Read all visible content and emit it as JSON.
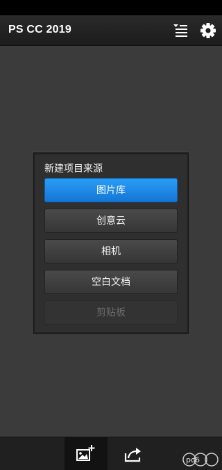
{
  "app": {
    "title": "PS CC 2019"
  },
  "toolbar": {
    "sort_icon": "sort-list-icon",
    "settings_icon": "gear-icon"
  },
  "dialog": {
    "title": "新建项目来源",
    "options": [
      {
        "label": "图片库",
        "state": "selected"
      },
      {
        "label": "创意云",
        "state": "normal"
      },
      {
        "label": "相机",
        "state": "normal"
      },
      {
        "label": "空白文档",
        "state": "normal"
      },
      {
        "label": "剪贴板",
        "state": "disabled"
      }
    ]
  },
  "bottom_bar": {
    "tabs": [
      {
        "icon": "add-image-icon",
        "active": true
      },
      {
        "icon": "share-icon",
        "active": false
      }
    ]
  },
  "watermark": {
    "text": "pc6"
  },
  "colors": {
    "accent": "#1a8ae8",
    "background": "#3b3b3b",
    "appbar": "#202020"
  }
}
